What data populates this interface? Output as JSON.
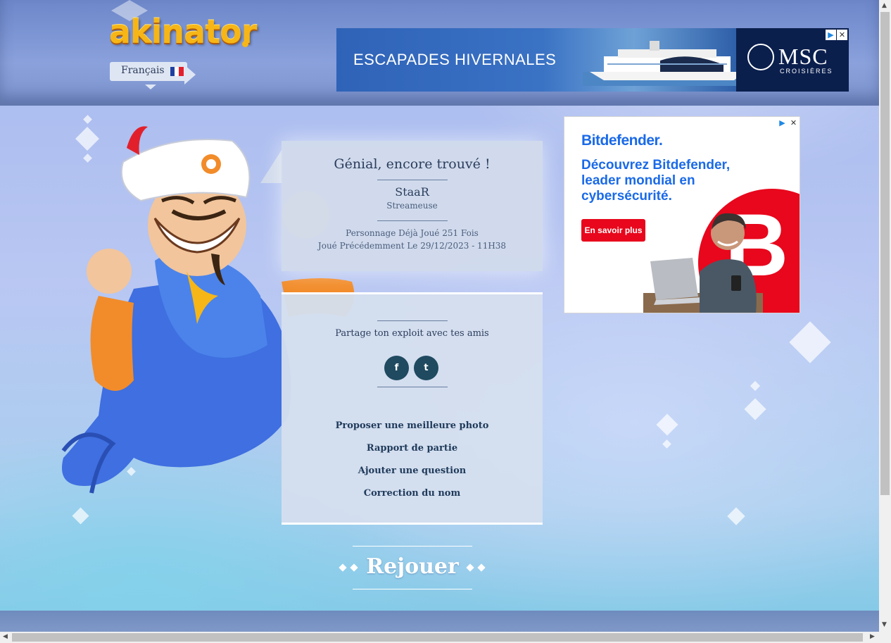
{
  "header": {
    "logo_text": "akinator",
    "language_label": "Français",
    "language_flag": "fr-flag"
  },
  "ad_banner": {
    "headline": "ESCAPADES HIVERNALES",
    "brand": "MSC",
    "brand_sub": "CROISIÈRES"
  },
  "result": {
    "title": "Génial, encore trouvé !",
    "character_name": "StaaR",
    "character_description": "Streameuse",
    "stat_played": "Personnage Déjà Joué 251 Fois",
    "stat_last": "Joué Précédemment Le 29/12/2023 - 11H38"
  },
  "share": {
    "text": "Partage ton exploit avec tes amis",
    "facebook_icon": "f",
    "twitter_icon": "t"
  },
  "links": [
    "Proposer une meilleure photo",
    "Rapport de partie",
    "Ajouter une question",
    "Correction du nom"
  ],
  "replay_label": "Rejouer",
  "side_ad": {
    "brand": "Bitdefender.",
    "copy": "Découvrez Bitdefender, leader mondial en cybersécurité.",
    "cta": "En savoir plus",
    "logo_letter": "B"
  },
  "colors": {
    "accent_dark": "#1f4a60",
    "panel": "#d4dfee",
    "text": "#2b3d5c",
    "logo_gold": "#f6b617",
    "bitdefender_red": "#e8071c",
    "bitdefender_blue": "#1a6ae8"
  }
}
